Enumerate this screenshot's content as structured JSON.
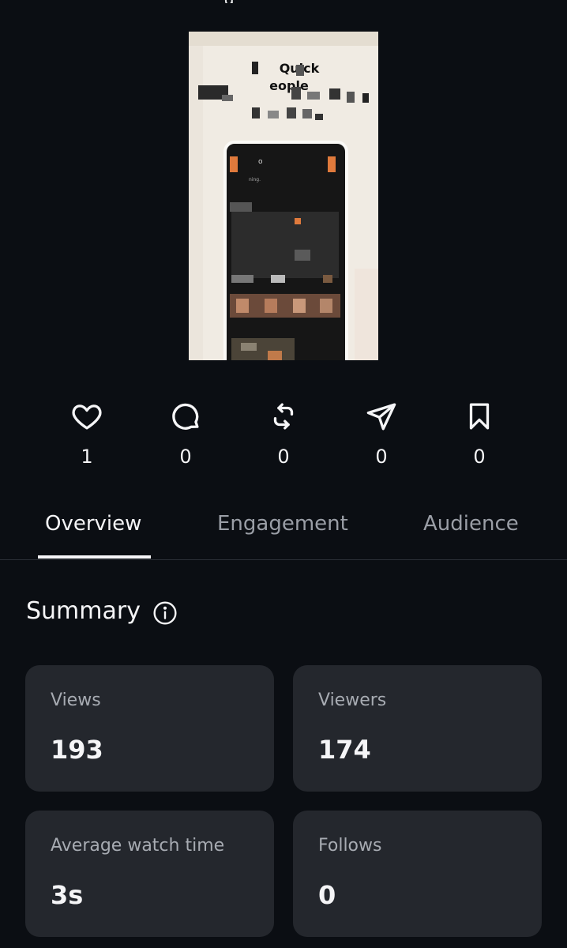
{
  "thumbnail": {
    "caption_line1": "Quick",
    "caption_line2": "eople",
    "phone_text1": "o",
    "phone_text2": "ning."
  },
  "actions": [
    {
      "name": "likes",
      "icon": "heart-icon",
      "count": "1"
    },
    {
      "name": "comments",
      "icon": "comment-icon",
      "count": "0"
    },
    {
      "name": "reposts",
      "icon": "repost-icon",
      "count": "0"
    },
    {
      "name": "shares",
      "icon": "send-icon",
      "count": "0"
    },
    {
      "name": "saves",
      "icon": "bookmark-icon",
      "count": "0"
    }
  ],
  "tabs": [
    {
      "label": "Overview",
      "active": true
    },
    {
      "label": "Engagement",
      "active": false
    },
    {
      "label": "Audience",
      "active": false
    }
  ],
  "summary": {
    "title": "Summary",
    "icon": "info-icon",
    "cards": [
      {
        "label": "Views",
        "value": "193"
      },
      {
        "label": "Viewers",
        "value": "174"
      },
      {
        "label": "Average watch time",
        "value": "3s"
      },
      {
        "label": "Follows",
        "value": "0"
      }
    ]
  },
  "colors": {
    "background": "#0b0e13",
    "card": "#24272d",
    "text_primary": "#f5f5f7",
    "text_secondary": "#a7abb2",
    "accent_thumb": "#e07a3c"
  }
}
